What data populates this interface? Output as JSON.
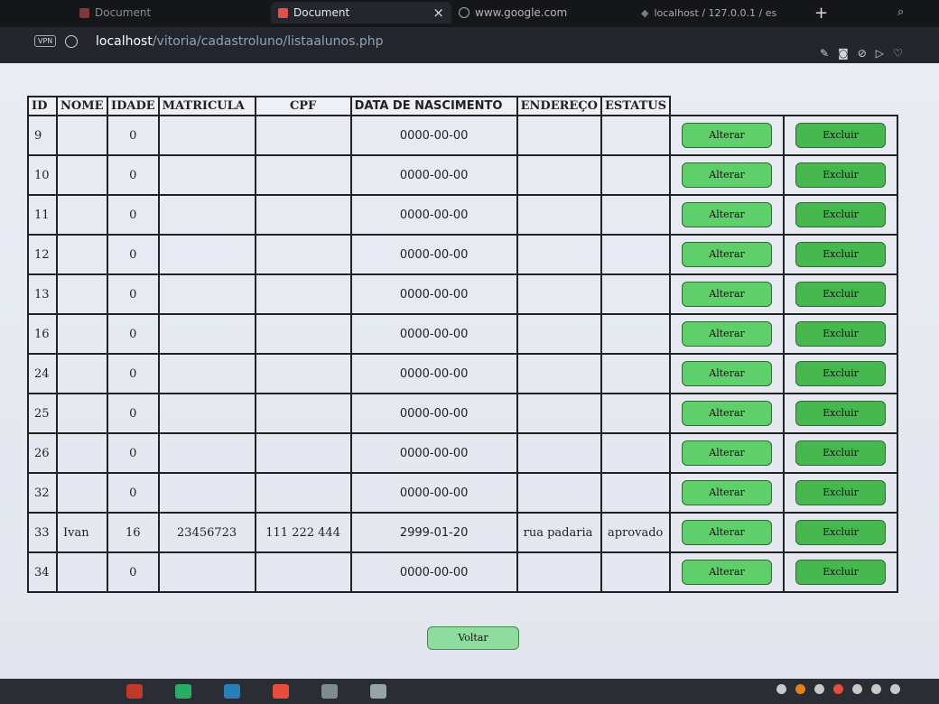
{
  "browser": {
    "tabs": [
      {
        "title": "Document"
      },
      {
        "title": "Document",
        "close": "×"
      },
      {
        "title": "www.google.com"
      },
      {
        "title": "localhost / 127.0.0.1 / es"
      }
    ],
    "new_tab": "+",
    "url_host": "localhost",
    "url_path": "/vitoria/cadastroluno/listaalunos.php",
    "vpn_label": "VPN"
  },
  "table": {
    "headers": [
      "ID",
      "NOME",
      "IDADE",
      "MATRICULA",
      "CPF",
      "DATA DE NASCIMENTO",
      "ENDEREÇO",
      "ESTATUS"
    ],
    "rows": [
      {
        "id": "9",
        "nome": "",
        "idade": "0",
        "matricula": "",
        "cpf": "",
        "data_nascimento": "0000-00-00",
        "endereco": "",
        "estatus": ""
      },
      {
        "id": "10",
        "nome": "",
        "idade": "0",
        "matricula": "",
        "cpf": "",
        "data_nascimento": "0000-00-00",
        "endereco": "",
        "estatus": ""
      },
      {
        "id": "11",
        "nome": "",
        "idade": "0",
        "matricula": "",
        "cpf": "",
        "data_nascimento": "0000-00-00",
        "endereco": "",
        "estatus": ""
      },
      {
        "id": "12",
        "nome": "",
        "idade": "0",
        "matricula": "",
        "cpf": "",
        "data_nascimento": "0000-00-00",
        "endereco": "",
        "estatus": ""
      },
      {
        "id": "13",
        "nome": "",
        "idade": "0",
        "matricula": "",
        "cpf": "",
        "data_nascimento": "0000-00-00",
        "endereco": "",
        "estatus": ""
      },
      {
        "id": "16",
        "nome": "",
        "idade": "0",
        "matricula": "",
        "cpf": "",
        "data_nascimento": "0000-00-00",
        "endereco": "",
        "estatus": ""
      },
      {
        "id": "24",
        "nome": "",
        "idade": "0",
        "matricula": "",
        "cpf": "",
        "data_nascimento": "0000-00-00",
        "endereco": "",
        "estatus": ""
      },
      {
        "id": "25",
        "nome": "",
        "idade": "0",
        "matricula": "",
        "cpf": "",
        "data_nascimento": "0000-00-00",
        "endereco": "",
        "estatus": ""
      },
      {
        "id": "26",
        "nome": "",
        "idade": "0",
        "matricula": "",
        "cpf": "",
        "data_nascimento": "0000-00-00",
        "endereco": "",
        "estatus": ""
      },
      {
        "id": "32",
        "nome": "",
        "idade": "0",
        "matricula": "",
        "cpf": "",
        "data_nascimento": "0000-00-00",
        "endereco": "",
        "estatus": ""
      },
      {
        "id": "33",
        "nome": "Ivan",
        "idade": "16",
        "matricula": "23456723",
        "cpf": "111 222 444",
        "data_nascimento": "2999-01-20",
        "endereco": "rua padaria",
        "estatus": "aprovado"
      },
      {
        "id": "34",
        "nome": "",
        "idade": "0",
        "matricula": "",
        "cpf": "",
        "data_nascimento": "0000-00-00",
        "endereco": "",
        "estatus": ""
      }
    ],
    "alter_label": "Alterar",
    "delete_label": "Excluir"
  },
  "back_label": "Voltar",
  "colors": {
    "button_alter": "#5fcf6b",
    "button_delete": "#47b84f",
    "button_back": "#8fdca0",
    "page_bg": "#e9ecf3"
  }
}
